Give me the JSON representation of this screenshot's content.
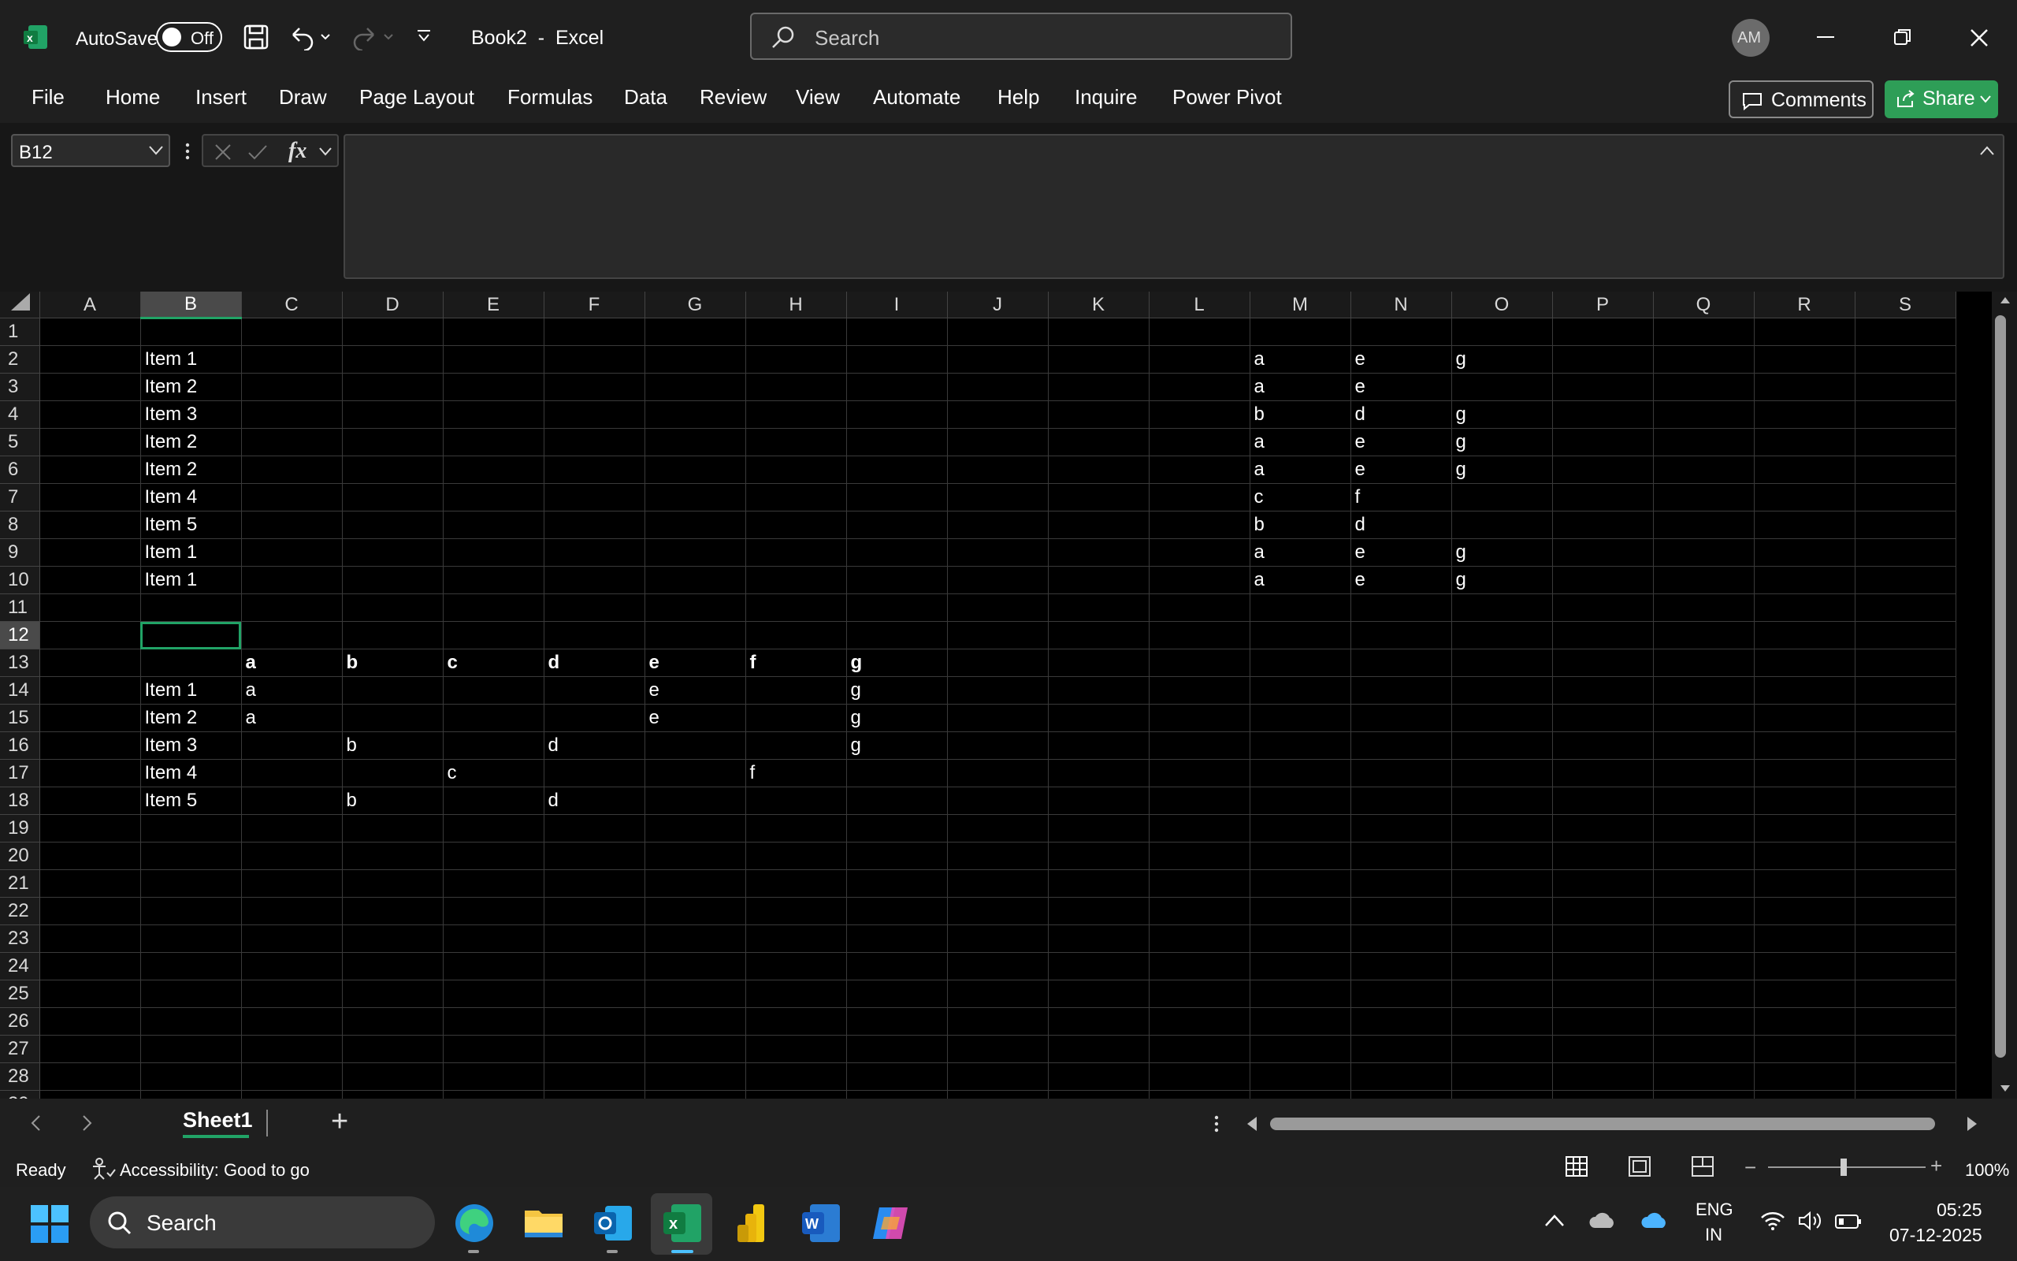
{
  "titlebar": {
    "autosave_label": "AutoSave",
    "autosave_toggle": "Off",
    "document_title": "Book2  -  Excel",
    "search_placeholder": "Search",
    "avatar_initials": "AM"
  },
  "menu": [
    "File",
    "Home",
    "Insert",
    "Draw",
    "Page Layout",
    "Formulas",
    "Data",
    "Review",
    "View",
    "Automate",
    "Help",
    "Inquire",
    "Power Pivot"
  ],
  "actions": {
    "comments": "Comments",
    "share": "Share"
  },
  "formula_bar": {
    "name_box": "B12",
    "fx": "fx",
    "content": ""
  },
  "grid": {
    "columns": [
      "A",
      "B",
      "C",
      "D",
      "E",
      "F",
      "G",
      "H",
      "I",
      "J",
      "K",
      "L",
      "M",
      "N",
      "O",
      "P",
      "Q",
      "R",
      "S"
    ],
    "selected_col": "B",
    "selected_row": 12,
    "active_cell": "B12",
    "rows": [
      {
        "n": "1",
        "cells": {}
      },
      {
        "n": "2",
        "cells": {
          "B": "Item 1",
          "M": "a",
          "N": "e",
          "O": "g"
        }
      },
      {
        "n": "3",
        "cells": {
          "B": "Item 2",
          "M": "a",
          "N": "e"
        }
      },
      {
        "n": "4",
        "cells": {
          "B": "Item 3",
          "M": "b",
          "N": "d",
          "O": "g"
        }
      },
      {
        "n": "5",
        "cells": {
          "B": "Item 2",
          "M": "a",
          "N": "e",
          "O": "g"
        }
      },
      {
        "n": "6",
        "cells": {
          "B": "Item 2",
          "M": "a",
          "N": "e",
          "O": "g"
        }
      },
      {
        "n": "7",
        "cells": {
          "B": "Item 4",
          "M": "c",
          "N": "f"
        }
      },
      {
        "n": "8",
        "cells": {
          "B": "Item 5",
          "M": "b",
          "N": "d"
        }
      },
      {
        "n": "9",
        "cells": {
          "B": "Item 1",
          "M": "a",
          "N": "e",
          "O": "g"
        }
      },
      {
        "n": "10",
        "cells": {
          "B": "Item 1",
          "M": "a",
          "N": "e",
          "O": "g"
        }
      },
      {
        "n": "11",
        "cells": {}
      },
      {
        "n": "12",
        "cells": {}
      },
      {
        "n": "13",
        "bold": true,
        "cells": {
          "C": "a",
          "D": "b",
          "E": "c",
          "F": "d",
          "G": "e",
          "H": "f",
          "I": "g"
        }
      },
      {
        "n": "14",
        "cells": {
          "B": "Item 1",
          "C": "a",
          "G": "e",
          "I": "g"
        }
      },
      {
        "n": "15",
        "cells": {
          "B": "Item 2",
          "C": "a",
          "G": "e",
          "I": "g"
        }
      },
      {
        "n": "16",
        "cells": {
          "B": "Item 3",
          "D": "b",
          "F": "d",
          "I": "g"
        }
      },
      {
        "n": "17",
        "cells": {
          "B": "Item 4",
          "E": "c",
          "H": "f"
        }
      },
      {
        "n": "18",
        "cells": {
          "B": "Item 5",
          "D": "b",
          "F": "d"
        }
      },
      {
        "n": "19",
        "cells": {}
      },
      {
        "n": "20",
        "cells": {}
      },
      {
        "n": "21",
        "cells": {}
      },
      {
        "n": "22",
        "cells": {}
      },
      {
        "n": "23",
        "cells": {}
      },
      {
        "n": "24",
        "cells": {}
      },
      {
        "n": "25",
        "cells": {}
      },
      {
        "n": "26",
        "cells": {}
      },
      {
        "n": "27",
        "cells": {}
      },
      {
        "n": "28",
        "cells": {}
      },
      {
        "n": "29",
        "cells": {}
      }
    ]
  },
  "sheets": {
    "active": "Sheet1",
    "add": "+"
  },
  "status": {
    "ready": "Ready",
    "accessibility": "Accessibility: Good to go",
    "zoom": "100%"
  },
  "taskbar": {
    "search": "Search",
    "lang_top": "ENG",
    "lang_bottom": "IN",
    "time": "05:25",
    "date": "07-12-2025"
  },
  "colors": {
    "accent_green": "#21a366",
    "share_green": "#2e9e57",
    "chrome": "#1f1f1f"
  }
}
